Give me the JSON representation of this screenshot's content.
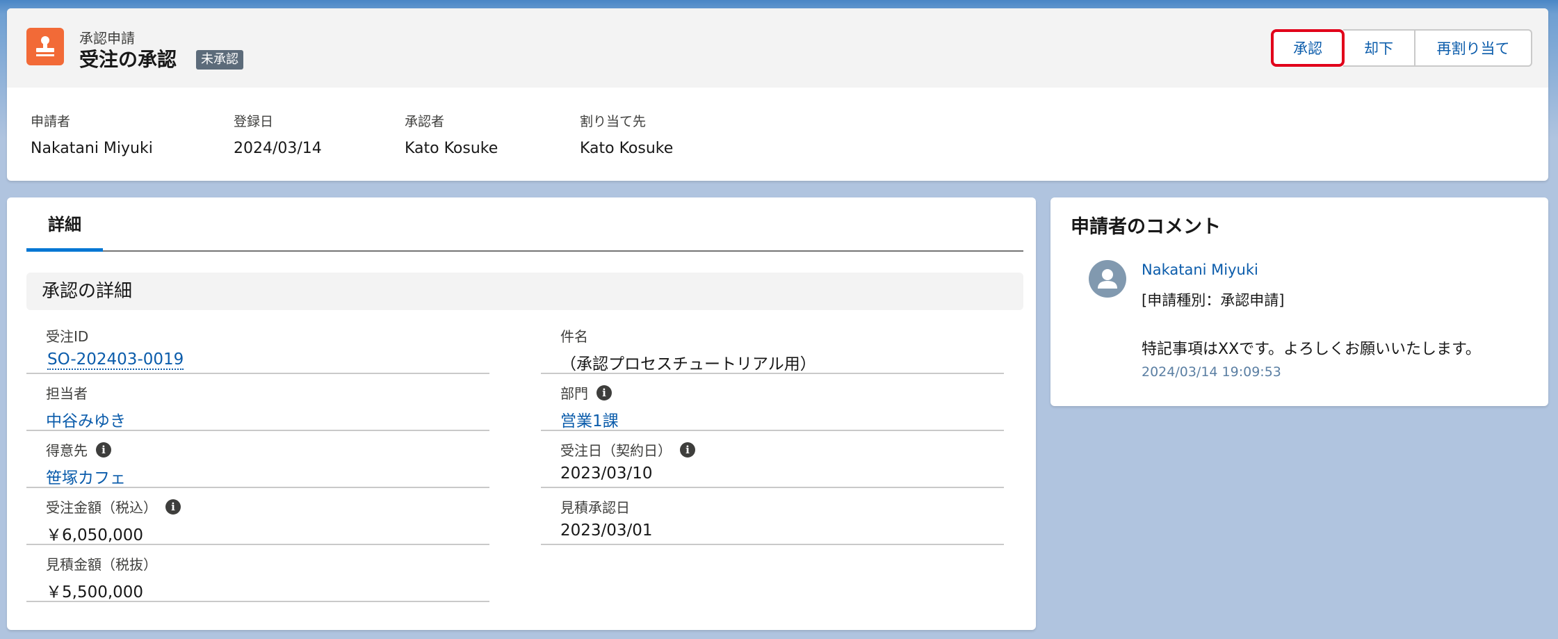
{
  "header": {
    "object_type": "承認申請",
    "title": "受注の承認",
    "status": "未承認",
    "buttons": {
      "approve": "承認",
      "reject": "却下",
      "reassign": "再割り当て"
    },
    "fields": [
      {
        "label": "申請者",
        "value": "Nakatani Miyuki"
      },
      {
        "label": "登録日",
        "value": "2024/03/14"
      },
      {
        "label": "承認者",
        "value": "Kato Kosuke"
      },
      {
        "label": "割り当て先",
        "value": "Kato Kosuke"
      }
    ]
  },
  "tabs": [
    {
      "label": "詳細",
      "active": true
    }
  ],
  "section": {
    "title": "承認の詳細",
    "fields": {
      "order_id": {
        "label": "受注ID",
        "value": "SO-202403-0019"
      },
      "subject": {
        "label": "件名",
        "value": "（承認プロセスチュートリアル用）"
      },
      "owner": {
        "label": "担当者",
        "value": "中谷みゆき"
      },
      "department": {
        "label": "部門",
        "value": "営業1課"
      },
      "customer": {
        "label": "得意先",
        "value": "笹塚カフェ"
      },
      "order_date": {
        "label": "受注日（契約日）",
        "value": "2023/03/10"
      },
      "order_amount": {
        "label": "受注金額（税込）",
        "value": "￥6,050,000"
      },
      "quote_approval_date": {
        "label": "見積承認日",
        "value": "2023/03/01"
      },
      "quote_amount": {
        "label": "見積金額（税抜）",
        "value": "￥5,500,000"
      }
    }
  },
  "comment_panel": {
    "title": "申請者のコメント",
    "author": "Nakatani Miyuki",
    "type_line": "[申請種別：承認申請]",
    "body": "特記事項はXXです。よろしくお願いいたします。",
    "timestamp": "2024/03/14 19:09:53"
  },
  "icons": {
    "object_icon": "stamp-icon",
    "info_icon": "info-icon",
    "avatar": "user-avatar-icon"
  },
  "colors": {
    "object_icon_bg": "#f26a37",
    "link": "#0b5cab",
    "tab_active": "#0176d3",
    "approve_highlight": "#e1001a",
    "status_badge": "#5c6b7a"
  }
}
